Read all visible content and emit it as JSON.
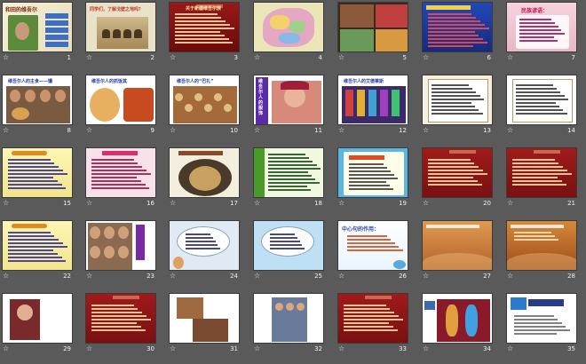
{
  "slides": [
    {
      "n": "1",
      "title": "和田的维吾尔",
      "tag": "title"
    },
    {
      "n": "2",
      "title": "同学们，了解戈壁之地吗？",
      "tag": "camels"
    },
    {
      "n": "3",
      "title": "关于新疆维吾尔族",
      "tag": "darktext"
    },
    {
      "n": "4",
      "title": "",
      "tag": "map"
    },
    {
      "n": "5",
      "title": "",
      "tag": "photos"
    },
    {
      "n": "6",
      "title": "",
      "tag": "redlist"
    },
    {
      "n": "7",
      "title": "民族谚语：",
      "tag": "proverb"
    },
    {
      "n": "8",
      "title": "维吾尔人的主食——馕",
      "tag": "naan"
    },
    {
      "n": "9",
      "title": "维吾尔人的抓饭其",
      "tag": "food"
    },
    {
      "n": "10",
      "title": "维吾尔人的“巴扎”",
      "tag": "bazaar"
    },
    {
      "n": "11",
      "title": "维吾尔人的服饰",
      "tag": "costume"
    },
    {
      "n": "12",
      "title": "维吾尔人的艾德莱斯",
      "tag": "shop"
    },
    {
      "n": "13",
      "title": "",
      "tag": "notes"
    },
    {
      "n": "14",
      "title": "",
      "tag": "notes2"
    },
    {
      "n": "15",
      "title": "",
      "tag": "yellowtext"
    },
    {
      "n": "16",
      "title": "",
      "tag": "pinktext"
    },
    {
      "n": "17",
      "title": "",
      "tag": "tonur"
    },
    {
      "n": "18",
      "title": "",
      "tag": "greentext"
    },
    {
      "n": "19",
      "title": "",
      "tag": "notepad"
    },
    {
      "n": "20",
      "title": "",
      "tag": "redtext"
    },
    {
      "n": "21",
      "title": "",
      "tag": "redtext2"
    },
    {
      "n": "22",
      "title": "",
      "tag": "yellowtext2"
    },
    {
      "n": "23",
      "title": "",
      "tag": "dance"
    },
    {
      "n": "24",
      "title": "",
      "tag": "bubble"
    },
    {
      "n": "25",
      "title": "",
      "tag": "bubble2"
    },
    {
      "n": "26",
      "title": "中心句的作用：",
      "tag": "blueinfo"
    },
    {
      "n": "27",
      "title": "",
      "tag": "desert"
    },
    {
      "n": "28",
      "title": "",
      "tag": "desert2"
    },
    {
      "n": "29",
      "title": "",
      "tag": "portrait"
    },
    {
      "n": "30",
      "title": "",
      "tag": "darkred"
    },
    {
      "n": "31",
      "title": "",
      "tag": "building"
    },
    {
      "n": "32",
      "title": "",
      "tag": "people"
    },
    {
      "n": "33",
      "title": "",
      "tag": "darkred2"
    },
    {
      "n": "34",
      "title": "",
      "tag": "dancers"
    },
    {
      "n": "35",
      "title": "",
      "tag": "logo"
    }
  ],
  "star_glyph": "☆"
}
